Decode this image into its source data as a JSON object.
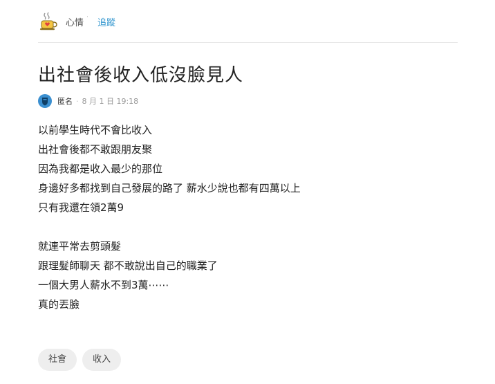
{
  "forum": {
    "icon": "coffee-cup-heart-icon",
    "name": "心情",
    "dot": "˙",
    "follow_label": "追蹤"
  },
  "post": {
    "title": "出社會後收入低沒臉見人",
    "author_avatar": "avatar-icon",
    "author": "匿名",
    "separator": "·",
    "time": "8 月 1 日 19:18",
    "lines": [
      "以前學生時代不會比收入",
      "出社會後都不敢跟朋友聚",
      "因為我都是收入最少的那位",
      "身邊好多都找到自己發展的路了 薪水少說也都有四萬以上",
      "只有我還在領2萬9",
      "",
      "就連平常去剪頭髮",
      "跟理髮師聊天 都不敢說出自己的職業了",
      "一個大男人薪水不到3萬⋯⋯",
      "真的丟臉"
    ]
  },
  "tags": [
    "社會",
    "收入"
  ],
  "colors": {
    "accent": "#3397cf",
    "tag_bg": "#eeeeee",
    "avatar": "#3a8fd0"
  }
}
